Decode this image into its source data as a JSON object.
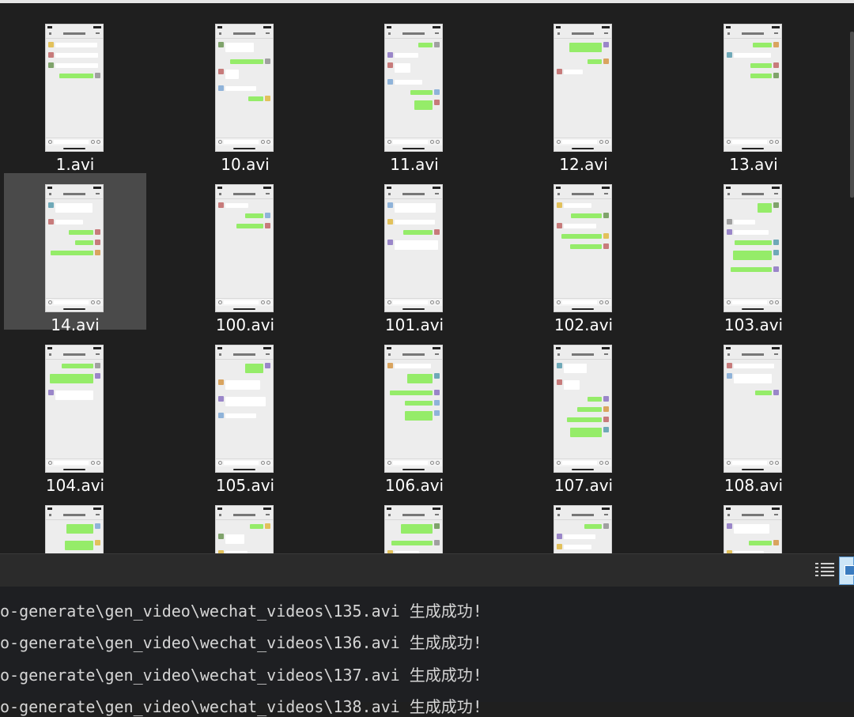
{
  "explorer": {
    "files": [
      {
        "name": "1.avi",
        "selected": false
      },
      {
        "name": "10.avi",
        "selected": false
      },
      {
        "name": "11.avi",
        "selected": false
      },
      {
        "name": "12.avi",
        "selected": false
      },
      {
        "name": "13.avi",
        "selected": false
      },
      {
        "name": "14.avi",
        "selected": true
      },
      {
        "name": "100.avi",
        "selected": false
      },
      {
        "name": "101.avi",
        "selected": false
      },
      {
        "name": "102.avi",
        "selected": false
      },
      {
        "name": "103.avi",
        "selected": false
      },
      {
        "name": "104.avi",
        "selected": false
      },
      {
        "name": "105.avi",
        "selected": false
      },
      {
        "name": "106.avi",
        "selected": false
      },
      {
        "name": "107.avi",
        "selected": false
      },
      {
        "name": "108.avi",
        "selected": false
      },
      {
        "name": "",
        "selected": false
      },
      {
        "name": "",
        "selected": false
      },
      {
        "name": "",
        "selected": false
      },
      {
        "name": "",
        "selected": false
      },
      {
        "name": "",
        "selected": false
      }
    ]
  },
  "toolbar": {
    "details_view_icon": "list-details-icon",
    "thumbnail_view_icon": "large-icons-view-icon"
  },
  "console": {
    "lines": [
      "o-generate\\gen_video\\wechat_videos\\135.avi 生成成功!",
      "o-generate\\gen_video\\wechat_videos\\136.avi 生成成功!",
      "o-generate\\gen_video\\wechat_videos\\137.avi 生成成功!",
      "o-generate\\gen_video\\wechat_videos\\138.avi 生成成功!"
    ]
  },
  "colors": {
    "background": "#1f1f1f",
    "selected_tile": "#4a4a4a",
    "chat_bubble_green": "#95ec69",
    "console_bg": "#1e1f22"
  }
}
